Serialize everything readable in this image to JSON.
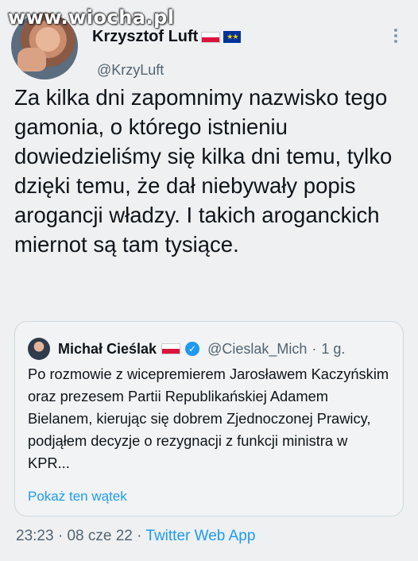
{
  "watermark": "www.wiocha.pl",
  "author": {
    "name": "Krzysztof Luft",
    "handle": "@KrzyLuft"
  },
  "tweet_text": "Za kilka dni zapomnimy nazwisko tego gamonia, o którego istnieniu dowiedzieliśmy się kilka dni temu, tylko dzięki temu, że dał niebywały popis arogancji władzy. I takich aroganckich miernot są tam tysiące.",
  "quoted": {
    "name": "Michał Cieślak",
    "verified_icon": "✓",
    "handle": "@Cieslak_Mich",
    "separator": "·",
    "time": "1 g.",
    "text": "Po rozmowie z wicepremierem Jarosławem Kaczyńskim oraz prezesem Partii Republikańskiej Adamem Bielanem, kierując się dobrem Zjednoczonej Prawicy, podjąłem decyzje o rezygnacji z funkcji ministra w KPR...",
    "show_thread": "Pokaż ten wątek"
  },
  "footer": {
    "time": "23:23",
    "sep1": "·",
    "date": "08 cze 22",
    "sep2": "·",
    "app": "Twitter Web App"
  },
  "colors": {
    "background": "#eef0f2",
    "text": "#0f1419",
    "secondary": "#536471",
    "link": "#1d9bf0"
  }
}
